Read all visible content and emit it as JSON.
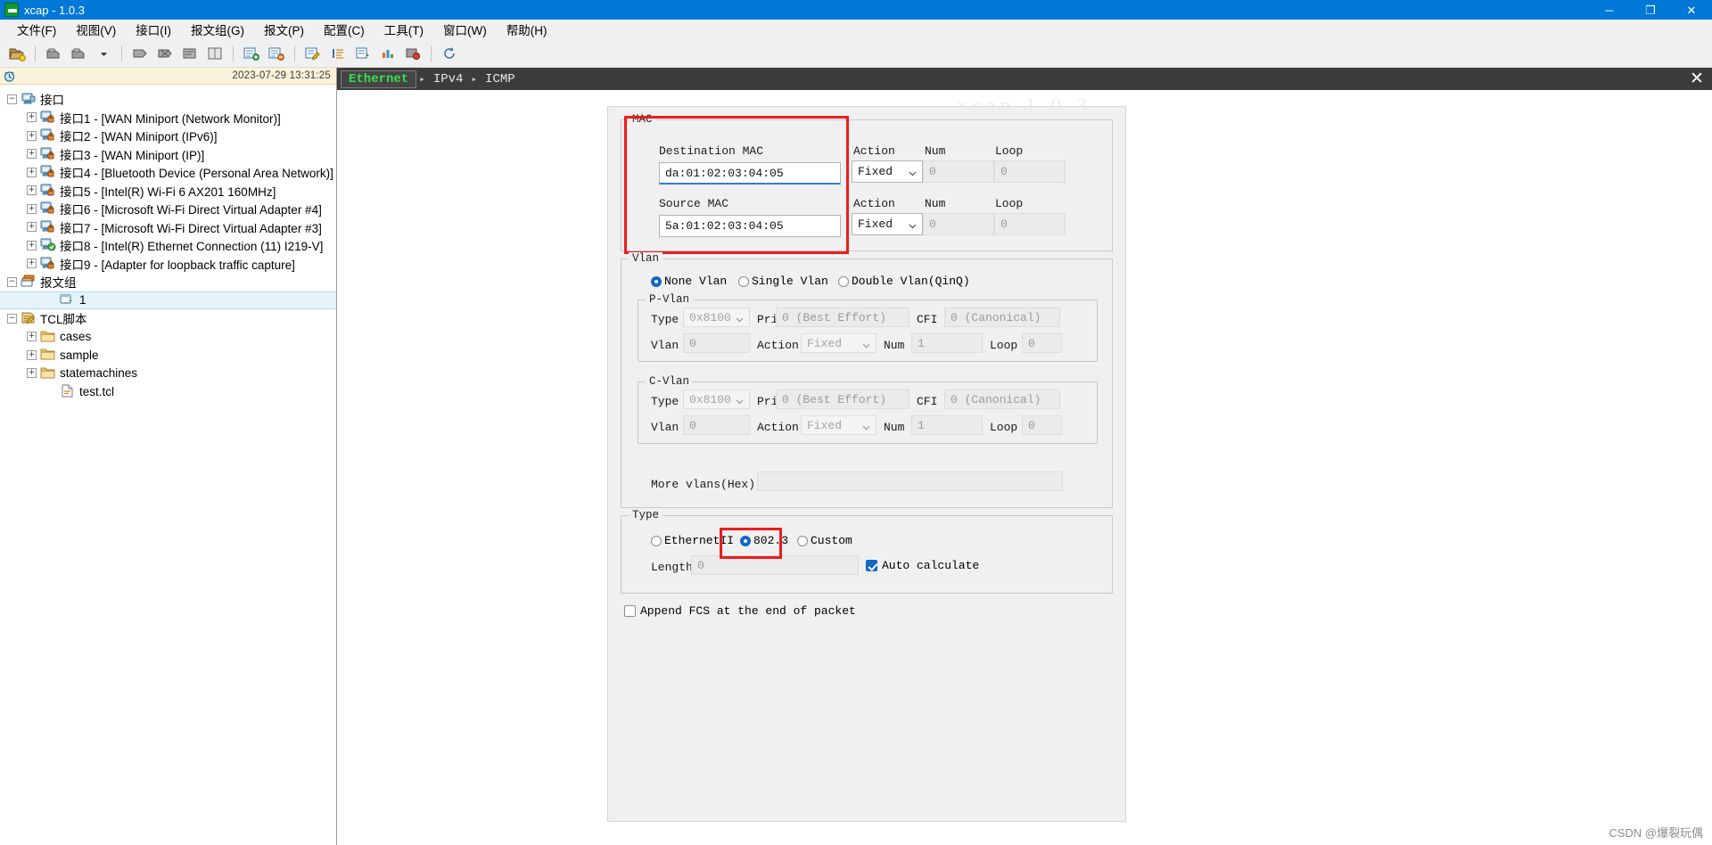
{
  "window": {
    "title": "xcap - 1.0.3",
    "app_icon": "xcap-icon",
    "minimize": "─",
    "maximize": "❐",
    "close": "✕",
    "ghost_title": "xcap 1.0.3"
  },
  "menubar": {
    "items": [
      {
        "label": "文件(F)"
      },
      {
        "label": "视图(V)"
      },
      {
        "label": "接口(I)"
      },
      {
        "label": "报文组(G)"
      },
      {
        "label": "报文(P)"
      },
      {
        "label": "配置(C)"
      },
      {
        "label": "工具(T)"
      },
      {
        "label": "窗口(W)"
      },
      {
        "label": "帮助(H)"
      }
    ]
  },
  "toolbar": {
    "buttons": [
      "open-folder-icon",
      "separator",
      "capture-icon",
      "capture-dropdown-icon",
      "dropdown-arrow-icon",
      "separator",
      "send-packet-icon",
      "stop-packet-icon",
      "packet-detail-icon",
      "book-icon",
      "separator",
      "add-group-icon",
      "remove-group-icon",
      "separator",
      "edit-packet-icon",
      "list-icon",
      "export-icon",
      "statistics-icon",
      "alert-icon",
      "separator",
      "refresh-icon"
    ]
  },
  "sidebar": {
    "timestamp": "2023-07-29 13:31:25",
    "clock_icon": "clock-icon",
    "tree": [
      {
        "label": "接口",
        "level": 0,
        "expander": "minus",
        "icon": "network-root-icon",
        "selected": false
      },
      {
        "label": "接口1 - [WAN Miniport (Network Monitor)]",
        "level": 1,
        "expander": "plus",
        "icon": "nic-locked-icon",
        "selected": false
      },
      {
        "label": "接口2 - [WAN Miniport (IPv6)]",
        "level": 1,
        "expander": "plus",
        "icon": "nic-locked-icon",
        "selected": false
      },
      {
        "label": "接口3 - [WAN Miniport (IP)]",
        "level": 1,
        "expander": "plus",
        "icon": "nic-locked-icon",
        "selected": false
      },
      {
        "label": "接口4 - [Bluetooth Device (Personal Area Network)]",
        "level": 1,
        "expander": "plus",
        "icon": "nic-locked-icon",
        "selected": false
      },
      {
        "label": "接口5 - [Intel(R) Wi-Fi 6 AX201 160MHz]",
        "level": 1,
        "expander": "plus",
        "icon": "nic-locked-icon",
        "selected": false
      },
      {
        "label": "接口6 - [Microsoft Wi-Fi Direct Virtual Adapter #4]",
        "level": 1,
        "expander": "plus",
        "icon": "nic-locked-icon",
        "selected": false
      },
      {
        "label": "接口7 - [Microsoft Wi-Fi Direct Virtual Adapter #3]",
        "level": 1,
        "expander": "plus",
        "icon": "nic-locked-icon",
        "selected": false
      },
      {
        "label": "接口8 - [Intel(R) Ethernet Connection (11) I219-V]",
        "level": 1,
        "expander": "plus",
        "icon": "nic-active-icon",
        "selected": false
      },
      {
        "label": "接口9 - [Adapter for loopback traffic capture]",
        "level": 1,
        "expander": "plus",
        "icon": "nic-locked-icon",
        "selected": false
      },
      {
        "label": "报文组",
        "level": 0,
        "expander": "minus",
        "icon": "packet-group-icon",
        "selected": false
      },
      {
        "label": "1",
        "level": 2,
        "expander": "none",
        "icon": "packet-icon",
        "selected": true
      },
      {
        "label": "TCL脚本",
        "level": 0,
        "expander": "minus",
        "icon": "script-icon",
        "selected": false
      },
      {
        "label": "cases",
        "level": 1,
        "expander": "plus",
        "icon": "folder-icon",
        "selected": false
      },
      {
        "label": "sample",
        "level": 1,
        "expander": "plus",
        "icon": "folder-icon",
        "selected": false
      },
      {
        "label": "statemachines",
        "level": 1,
        "expander": "plus",
        "icon": "folder-icon",
        "selected": false
      },
      {
        "label": "test.tcl",
        "level": 2,
        "expander": "none",
        "icon": "tcl-file-icon",
        "selected": false
      }
    ]
  },
  "breadcrumb": {
    "items": [
      {
        "label": "Ethernet",
        "active": true
      },
      {
        "label": "IPv4",
        "active": false
      },
      {
        "label": "ICMP",
        "active": false
      }
    ],
    "separator": "▸",
    "close_label": "✕",
    "active_color": "#35e04a"
  },
  "editor": {
    "mac": {
      "group_label": "MAC",
      "highlight_color": "#ee1c1c",
      "dest_label": "Destination MAC",
      "dest_value": "da:01:02:03:04:05",
      "src_label": "Source MAC",
      "src_value": "5a:01:02:03:04:05",
      "col_action": "Action",
      "col_num": "Num",
      "col_loop": "Loop",
      "dest_action": "Fixed",
      "dest_num": "0",
      "dest_loop": "0",
      "src_action": "Fixed",
      "src_num": "0",
      "src_loop": "0"
    },
    "vlan": {
      "group_label": "Vlan",
      "modes": [
        {
          "label": "None Vlan",
          "selected": true
        },
        {
          "label": "Single Vlan",
          "selected": false
        },
        {
          "label": "Double Vlan(QinQ)",
          "selected": false
        }
      ],
      "pvlan": {
        "group_label": "P-Vlan",
        "type_label": "Type",
        "type_value": "0x8100",
        "pri_label": "Pri",
        "pri_value": "0 (Best Effort)",
        "cfi_label": "CFI",
        "cfi_value": "0 (Canonical)",
        "vlan_label": "Vlan",
        "vlan_value": "0",
        "action_label": "Action",
        "action_value": "Fixed",
        "num_label": "Num",
        "num_value": "1",
        "loop_label": "Loop",
        "loop_value": "0"
      },
      "cvlan": {
        "group_label": "C-Vlan",
        "type_label": "Type",
        "type_value": "0x8100",
        "pri_label": "Pri",
        "pri_value": "0 (Best Effort)",
        "cfi_label": "CFI",
        "cfi_value": "0 (Canonical)",
        "vlan_label": "Vlan",
        "vlan_value": "0",
        "action_label": "Action",
        "action_value": "Fixed",
        "num_label": "Num",
        "num_value": "1",
        "loop_label": "Loop",
        "loop_value": "0"
      },
      "more_vlans_label": "More vlans(Hex)",
      "more_vlans_value": ""
    },
    "type": {
      "group_label": "Type",
      "options": [
        {
          "label": "EthernetII",
          "selected": false
        },
        {
          "label": "802.3",
          "selected": true
        },
        {
          "label": "Custom",
          "selected": false
        }
      ],
      "highlight_color": "#ee1c1c",
      "length_label": "Length",
      "length_value": "0",
      "auto_calculate_label": "Auto calculate",
      "auto_calculate_checked": true
    },
    "append_fcs_label": "Append FCS at the end of packet",
    "append_fcs_checked": false
  },
  "watermark": "CSDN @爆裂玩偶"
}
